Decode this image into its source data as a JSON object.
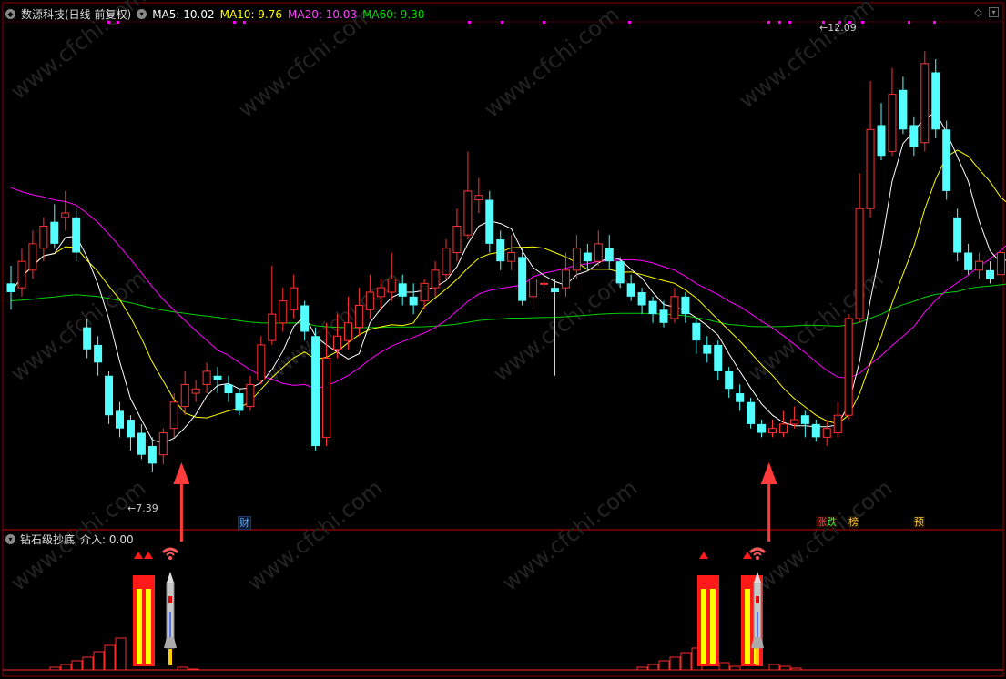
{
  "header": {
    "title": "数源科技(日线 前复权)",
    "ma5": "MA5: 10.02",
    "ma10": "MA10: 9.76",
    "ma20": "MA20: 10.03",
    "ma60": "MA60: 9.30"
  },
  "annotations": {
    "low": "7.39",
    "high": "12.09"
  },
  "tags": {
    "cai": "财",
    "zhangdie": "涨跌",
    "bang": "榜",
    "yu": "预"
  },
  "subchart": {
    "title": "钻石级抄底",
    "value": "介入: 0.00"
  },
  "watermark": "www.cfchi.com",
  "colors": {
    "up": "#ff3232",
    "down": "#54ffff",
    "ma5": "#ffffff",
    "ma10": "#ffff00",
    "ma20": "#ff00ff",
    "ma60": "#00d000"
  },
  "chart_data": {
    "type": "candlestick",
    "price_range": [
      7.0,
      12.3
    ],
    "candles": [
      [
        9.45,
        9.35,
        9.65,
        9.15
      ],
      [
        9.4,
        9.7,
        9.85,
        9.3
      ],
      [
        9.6,
        9.9,
        10.05,
        9.5
      ],
      [
        9.85,
        10.1,
        10.2,
        9.7
      ],
      [
        10.15,
        9.9,
        10.35,
        9.85
      ],
      [
        10.2,
        10.25,
        10.5,
        10.05
      ],
      [
        10.2,
        9.8,
        10.3,
        9.7
      ],
      [
        8.95,
        8.7,
        9.05,
        8.6
      ],
      [
        8.75,
        8.55,
        8.85,
        8.4
      ],
      [
        8.4,
        7.95,
        8.45,
        7.85
      ],
      [
        8.0,
        7.8,
        8.1,
        7.7
      ],
      [
        7.9,
        7.7,
        7.95,
        7.55
      ],
      [
        7.75,
        7.5,
        7.85,
        7.45
      ],
      [
        7.6,
        7.4,
        7.7,
        7.3
      ],
      [
        7.5,
        7.75,
        7.8,
        7.39
      ],
      [
        7.8,
        8.1,
        8.2,
        7.7
      ],
      [
        8.05,
        8.3,
        8.45,
        7.95
      ],
      [
        8.2,
        8.25,
        8.35,
        8.1
      ],
      [
        8.3,
        8.45,
        8.55,
        8.2
      ],
      [
        8.4,
        8.35,
        8.5,
        8.2
      ],
      [
        8.3,
        8.2,
        8.4,
        8.1
      ],
      [
        8.2,
        8.0,
        8.25,
        7.95
      ],
      [
        8.05,
        8.3,
        8.4,
        8.0
      ],
      [
        8.35,
        8.75,
        8.85,
        8.3
      ],
      [
        8.8,
        9.1,
        9.65,
        8.75
      ],
      [
        9.0,
        9.25,
        9.4,
        8.9
      ],
      [
        9.15,
        9.4,
        9.55,
        9.05
      ],
      [
        9.2,
        8.9,
        9.25,
        8.8
      ],
      [
        8.85,
        7.6,
        8.95,
        7.55
      ],
      [
        7.7,
        8.6,
        9.0,
        7.6
      ],
      [
        8.7,
        8.85,
        9.1,
        8.6
      ],
      [
        8.8,
        9.0,
        9.3,
        8.7
      ],
      [
        8.95,
        9.2,
        9.4,
        8.85
      ],
      [
        9.15,
        9.35,
        9.55,
        9.05
      ],
      [
        9.3,
        9.4,
        9.5,
        9.15
      ],
      [
        9.35,
        9.5,
        9.8,
        9.25
      ],
      [
        9.45,
        9.3,
        9.55,
        9.2
      ],
      [
        9.3,
        9.2,
        9.45,
        9.1
      ],
      [
        9.25,
        9.45,
        9.5,
        9.15
      ],
      [
        9.4,
        9.6,
        9.7,
        9.3
      ],
      [
        9.55,
        9.85,
        9.95,
        9.5
      ],
      [
        9.8,
        10.1,
        10.3,
        9.7
      ],
      [
        10.0,
        10.5,
        10.95,
        9.95
      ],
      [
        10.4,
        10.45,
        10.65,
        10.25
      ],
      [
        10.4,
        9.9,
        10.5,
        9.8
      ],
      [
        9.95,
        9.7,
        10.05,
        9.6
      ],
      [
        9.7,
        9.8,
        10.0,
        9.6
      ],
      [
        9.75,
        9.25,
        9.85,
        9.2
      ],
      [
        9.3,
        9.5,
        9.6,
        9.15
      ],
      [
        9.45,
        9.45,
        9.55,
        9.35
      ],
      [
        9.4,
        9.35,
        9.5,
        8.4
      ],
      [
        9.4,
        9.6,
        9.8,
        9.3
      ],
      [
        9.6,
        9.85,
        10.0,
        9.5
      ],
      [
        9.8,
        9.7,
        9.9,
        9.6
      ],
      [
        9.7,
        9.9,
        10.05,
        9.65
      ],
      [
        9.85,
        9.7,
        10.0,
        9.6
      ],
      [
        9.7,
        9.45,
        9.75,
        9.4
      ],
      [
        9.45,
        9.3,
        9.55,
        9.25
      ],
      [
        9.35,
        9.2,
        9.4,
        9.1
      ],
      [
        9.25,
        9.1,
        9.3,
        9.0
      ],
      [
        9.15,
        9.0,
        9.25,
        8.95
      ],
      [
        9.05,
        9.3,
        9.4,
        9.0
      ],
      [
        9.3,
        9.1,
        9.35,
        9.0
      ],
      [
        9.0,
        8.8,
        9.05,
        8.65
      ],
      [
        8.75,
        8.65,
        8.85,
        8.55
      ],
      [
        8.75,
        8.45,
        8.8,
        8.35
      ],
      [
        8.45,
        8.25,
        8.5,
        8.15
      ],
      [
        8.2,
        8.1,
        8.3,
        8.0
      ],
      [
        8.1,
        7.85,
        8.15,
        7.8
      ],
      [
        7.85,
        7.75,
        7.9,
        7.7
      ],
      [
        7.75,
        7.8,
        7.9,
        7.7
      ],
      [
        7.75,
        7.85,
        8.0,
        7.7
      ],
      [
        7.85,
        7.9,
        8.05,
        7.8
      ],
      [
        7.95,
        7.85,
        8.0,
        7.7
      ],
      [
        7.85,
        7.7,
        7.9,
        7.65
      ],
      [
        7.7,
        7.8,
        7.9,
        7.6
      ],
      [
        7.75,
        7.95,
        8.1,
        7.7
      ],
      [
        7.95,
        9.05,
        9.1,
        7.9
      ],
      [
        9.05,
        10.3,
        10.7,
        9.0
      ],
      [
        10.3,
        11.2,
        11.75,
        10.2
      ],
      [
        11.25,
        10.9,
        11.5,
        10.85
      ],
      [
        10.95,
        11.6,
        11.9,
        10.9
      ],
      [
        11.65,
        11.2,
        11.8,
        11.15
      ],
      [
        11.25,
        11.0,
        11.35,
        10.9
      ],
      [
        11.05,
        11.95,
        12.09,
        10.95
      ],
      [
        11.85,
        11.2,
        12.0,
        11.1
      ],
      [
        11.2,
        10.5,
        11.3,
        10.4
      ],
      [
        10.2,
        9.8,
        10.3,
        9.7
      ],
      [
        9.8,
        9.6,
        9.9,
        9.55
      ],
      [
        9.6,
        9.7,
        9.8,
        9.5
      ],
      [
        9.6,
        9.5,
        9.7,
        9.45
      ],
      [
        9.55,
        9.8,
        9.9,
        9.5
      ],
      [
        9.85,
        10.2,
        10.35,
        9.8
      ],
      [
        10.2,
        10.0,
        10.3,
        9.95
      ],
      [
        10.05,
        10.3,
        10.4,
        10.0
      ],
      [
        10.3,
        10.1,
        10.4,
        10.05
      ],
      [
        10.15,
        10.3,
        10.4,
        10.1
      ]
    ],
    "signals_at": [
      12,
      66
    ],
    "wifi_at": [
      14,
      68
    ]
  }
}
